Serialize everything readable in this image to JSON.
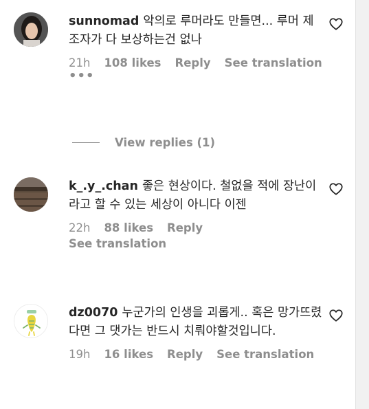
{
  "comments": [
    {
      "username": "sunnomad",
      "text": "악의로 루머라도 만들면... 루머 제조자가 다 보상하는건 없나",
      "time": "21h",
      "likes": "108 likes",
      "reply": "Reply",
      "see_translation": "See translation",
      "more_icon": "more-icon"
    },
    {
      "username": "k_.y_.chan",
      "text": "좋은 현상이다. 철없을 적에 장난이라고 할 수 있는 세상이 아니다 이젠",
      "time": "22h",
      "likes": "88 likes",
      "reply": "Reply",
      "see_translation": "See translation"
    },
    {
      "username": "dz0070",
      "text": "누군가의 인생을 괴롭게.. 혹은 망가뜨렸다면 그 댓가는 반드시 치뤄야할것입니다.",
      "time": "19h",
      "likes": "16 likes",
      "reply": "Reply",
      "see_translation": "See translation"
    }
  ],
  "view_replies": "View replies (1)",
  "icons": {
    "heart": "heart-icon",
    "more": "more-icon"
  },
  "colors": {
    "text": "#262626",
    "secondary": "#8e8e8e",
    "background": "#ffffff"
  }
}
